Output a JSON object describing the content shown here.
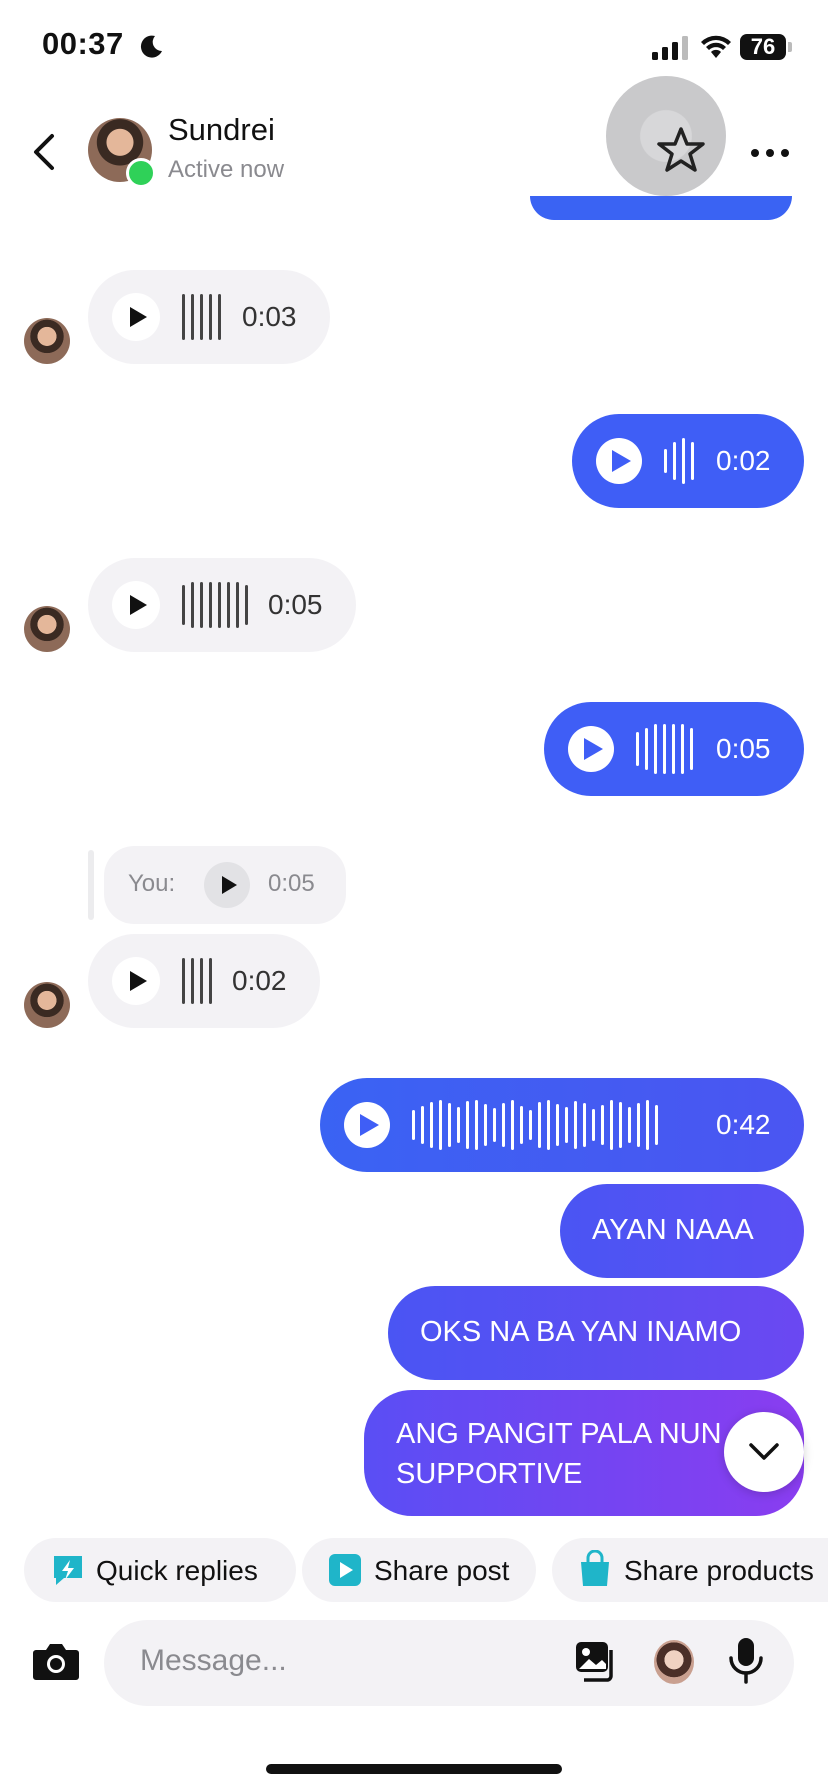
{
  "status_bar": {
    "time": "00:37",
    "battery": "76"
  },
  "header": {
    "contact_name": "Sundrei",
    "contact_status": "Active now"
  },
  "messages": [
    {
      "direction": "in",
      "type": "voice",
      "duration": "0:03"
    },
    {
      "direction": "out",
      "type": "voice",
      "duration": "0:02"
    },
    {
      "direction": "in",
      "type": "voice",
      "duration": "0:05"
    },
    {
      "direction": "out",
      "type": "voice",
      "duration": "0:05"
    },
    {
      "direction": "in",
      "type": "voice",
      "duration": "0:02",
      "reply_to": {
        "label": "You:",
        "duration": "0:05"
      }
    },
    {
      "direction": "out",
      "type": "voice",
      "duration": "0:42"
    },
    {
      "direction": "out",
      "type": "text",
      "text": "AYAN NAAA"
    },
    {
      "direction": "out",
      "type": "text",
      "text": "OKS NA BA YAN INAMO"
    },
    {
      "direction": "out",
      "type": "text",
      "text": "ANG PANGIT PALA NUN SUPPORTIVE"
    }
  ],
  "quick_actions": [
    {
      "label": "Quick replies",
      "icon": "lightning-icon"
    },
    {
      "label": "Share post",
      "icon": "play-icon"
    },
    {
      "label": "Share products",
      "icon": "shopping-bag-icon"
    }
  ],
  "composer": {
    "placeholder": "Message..."
  },
  "colors": {
    "outgoing": "#3f5ef6",
    "incoming": "#f3f2f5",
    "online": "#2fd158",
    "accent_teal": "#1fb5c9"
  }
}
